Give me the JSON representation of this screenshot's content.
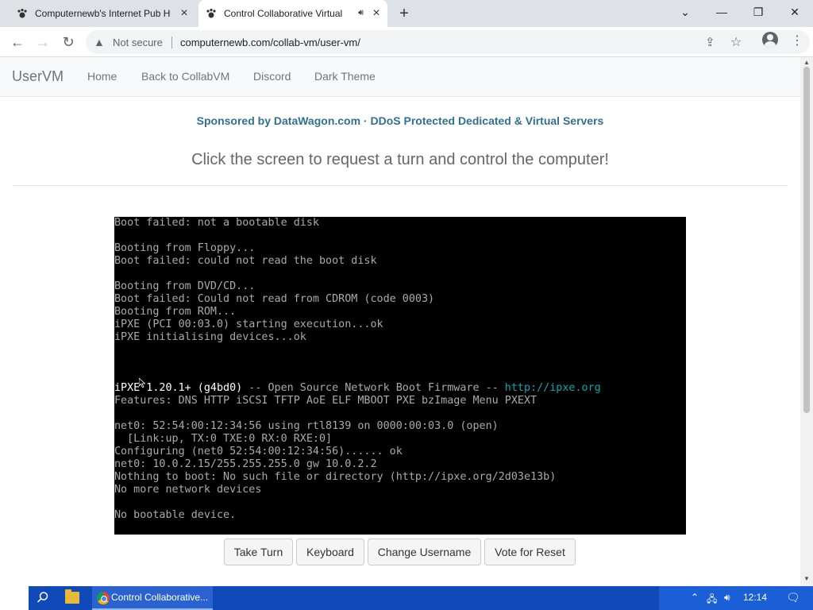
{
  "browser": {
    "tabs": [
      {
        "title": "Computernewb's Internet Pub Hu",
        "favicon": "paw-icon",
        "active": false
      },
      {
        "title": "Control Collaborative Virtual",
        "favicon": "paw-icon",
        "active": true,
        "audio": true
      }
    ],
    "new_tab_symbol": "+",
    "security_label": "Not secure",
    "url": "computernewb.com/collab-vm/user-vm/"
  },
  "site": {
    "brand": "UserVM",
    "nav": [
      "Home",
      "Back to CollabVM",
      "Discord",
      "Dark Theme"
    ],
    "sponsor": "Sponsored by DataWagon.com · DDoS Protected Dedicated & Virtual Servers",
    "instructions": "Click the screen to request a turn and control the computer!",
    "buttons": {
      "take_turn": "Take Turn",
      "keyboard": "Keyboard",
      "change_username": "Change Username",
      "vote_reset": "Vote for Reset"
    }
  },
  "console": {
    "lines": [
      "Boot failed: not a bootable disk",
      "",
      "Booting from Floppy...",
      "Boot failed: could not read the boot disk",
      "",
      "Booting from DVD/CD...",
      "Boot failed: Could not read from CDROM (code 0003)",
      "Booting from ROM...",
      "iPXE (PCI 00:03.0) starting execution...ok",
      "iPXE initialising devices...ok",
      "",
      "",
      "",
      "",
      "Features: DNS HTTP iSCSI TFTP AoE ELF MBOOT PXE bzImage Menu PXEXT",
      "",
      "net0: 52:54:00:12:34:56 using rtl8139 on 0000:00:03.0 (open)",
      "  [Link:up, TX:0 TXE:0 RX:0 RXE:0]",
      "Configuring (net0 52:54:00:12:34:56)...... ok",
      "net0: 10.0.2.15/255.255.255.0 gw 10.0.2.2",
      "Nothing to boot: No such file or directory (http://ipxe.org/2d03e13b)",
      "No more network devices",
      "",
      "No bootable device."
    ],
    "banner": {
      "product": "iPXE 1.20.1+ (g4bd0)",
      "middle": " -- Open Source Network Boot Firmware -- ",
      "link": "http://ipxe.org"
    }
  },
  "taskbar": {
    "app_label": "Control Collaborative...",
    "clock": "12:14"
  },
  "colors": {
    "sponsor": "#31708f",
    "console_text": "#aaaaaa",
    "console_link": "#00aaaa",
    "taskbar": "#0f4ab8"
  }
}
